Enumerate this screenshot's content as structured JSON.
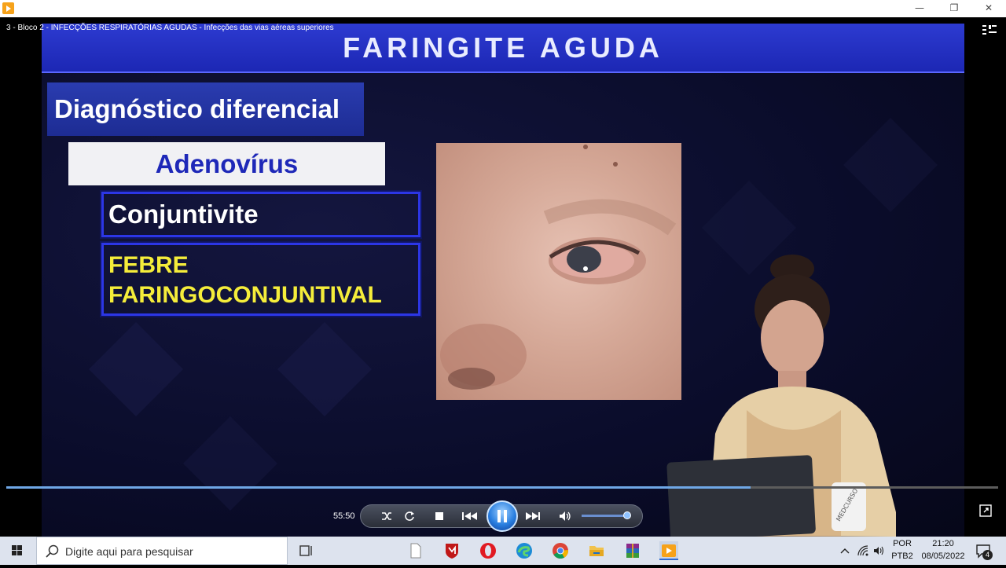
{
  "window": {
    "minimize_glyph": "—",
    "restore_glyph": "❐",
    "close_glyph": "✕"
  },
  "video": {
    "title": "3 - Bloco 2 - INFECÇÕES RESPIRATÓRIAS AGUDAS - Infecções das vias aéreas superiores"
  },
  "slide": {
    "header": "Faringite Aguda",
    "diag_label": "Diagnóstico diferencial",
    "adeno_label": "Adenovírus",
    "conj_label": "Conjuntivite",
    "febre_line1": "FEBRE",
    "febre_line2": "FARINGOCONJUNTIVAL"
  },
  "presenter": {
    "mug_text": "MEDCURSO"
  },
  "player": {
    "time": "55:50",
    "progress": 0.75,
    "volume": 0.95,
    "icons": {
      "shuffle": "shuffle-icon",
      "repeat": "repeat-icon",
      "stop": "stop-icon",
      "prev": "previous-icon",
      "pause": "pause-icon",
      "next": "next-icon",
      "volume": "volume-icon"
    }
  },
  "taskbar": {
    "search_placeholder": "Digite aqui para pesquisar",
    "lang_top": "POR",
    "lang_bottom": "PTB2",
    "clock_time": "21:20",
    "clock_date": "08/05/2022",
    "notification_count": "4",
    "apps": [
      "task-view-icon",
      "file-icon",
      "mcafee-icon",
      "opera-icon",
      "edge-icon",
      "chrome-icon",
      "file-explorer-icon",
      "winrar-icon",
      "media-player-icon"
    ]
  }
}
